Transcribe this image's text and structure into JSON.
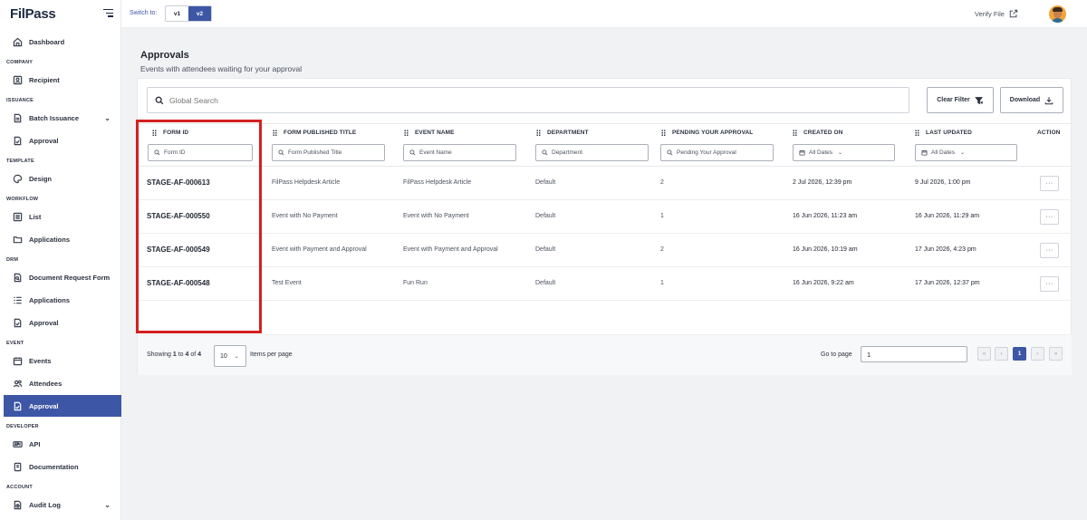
{
  "app": {
    "logo": "FilPass",
    "logo_mark": "✓"
  },
  "topbar": {
    "switch_label": "Switch to:",
    "versions": [
      "v1",
      "v2"
    ],
    "selected_version": "v2",
    "verify_label": "Verify File"
  },
  "sidebar": {
    "dashboard": "Dashboard",
    "sections": {
      "company": "COMPANY",
      "issuance": "ISSUANCE",
      "template": "TEMPLATE",
      "workflow": "WORKFLOW",
      "drm": "DRM",
      "event": "EVENT",
      "developer": "DEVELOPER",
      "account": "ACCOUNT"
    },
    "items": {
      "recipient": "Recipient",
      "batch_issuance": "Batch Issuance",
      "issuance_approval": "Approval",
      "design": "Design",
      "list": "List",
      "workflow_applications": "Applications",
      "document_request_form": "Document Request Form",
      "drm_applications": "Applications",
      "drm_approval": "Approval",
      "events": "Events",
      "attendees": "Attendees",
      "event_approval": "Approval",
      "api": "API",
      "documentation": "Documentation",
      "audit_log": "Audit Log"
    },
    "active_item": "event_approval"
  },
  "page": {
    "title": "Approvals",
    "subtitle": "Events with attendees waiting for your approval"
  },
  "toolbar": {
    "search_placeholder": "Global Search",
    "clear_filter": "Clear Filter",
    "download": "Download"
  },
  "table": {
    "columns": {
      "form_id": "FORM ID",
      "form_title": "FORM PUBLISHED TITLE",
      "event_name": "EVENT NAME",
      "department": "DEPARTMENT",
      "pending": "PENDING YOUR APPROVAL",
      "created_on": "CREATED ON",
      "last_updated": "LAST UPDATED",
      "action": "ACTION"
    },
    "filters": {
      "form_id": "Form ID",
      "form_title": "Form Published Title",
      "event_name": "Event Name",
      "department": "Department",
      "pending": "Pending Your Approval",
      "created_on": "All Dates",
      "last_updated": "All Dates"
    },
    "rows": [
      {
        "form_id": "STAGE-AF-000613",
        "form_title": "FilPass Helpdesk Article",
        "event_name": "FilPass Helpdesk Article",
        "department": "Default",
        "pending": "2",
        "created_on": "2 Jul 2026, 12:39 pm",
        "last_updated": "9 Jul 2026, 1:00 pm",
        "action": "···"
      },
      {
        "form_id": "STAGE-AF-000550",
        "form_title": "Event with No Payment",
        "event_name": "Event with No Payment",
        "department": "Default",
        "pending": "1",
        "created_on": "16 Jun 2026, 11:23 am",
        "last_updated": "16 Jun 2026, 11:29 am",
        "action": "···"
      },
      {
        "form_id": "STAGE-AF-000549",
        "form_title": "Event with Payment and Approval",
        "event_name": "Event with Payment and Approval",
        "department": "Default",
        "pending": "2",
        "created_on": "16 Jun 2026, 10:19 am",
        "last_updated": "17 Jun 2026, 4:23 pm",
        "action": "···"
      },
      {
        "form_id": "STAGE-AF-000548",
        "form_title": "Test Event",
        "event_name": "Fun Run",
        "department": "Default",
        "pending": "1",
        "created_on": "16 Jun 2026, 9:22 am",
        "last_updated": "17 Jun 2026, 12:37 pm",
        "action": "···"
      }
    ]
  },
  "pagination": {
    "showing_prefix": "Showing",
    "from": "1",
    "to_word": "to",
    "to": "4",
    "of_word": "of",
    "total": "4",
    "per_page": "10",
    "per_page_label": "Items per page",
    "goto_label": "Go to page",
    "goto_value": "1",
    "first": "«",
    "prev": "‹",
    "current": "1",
    "next": "›",
    "last": "»"
  },
  "colors": {
    "accent": "#3d56a6",
    "highlight": "#d42020"
  }
}
